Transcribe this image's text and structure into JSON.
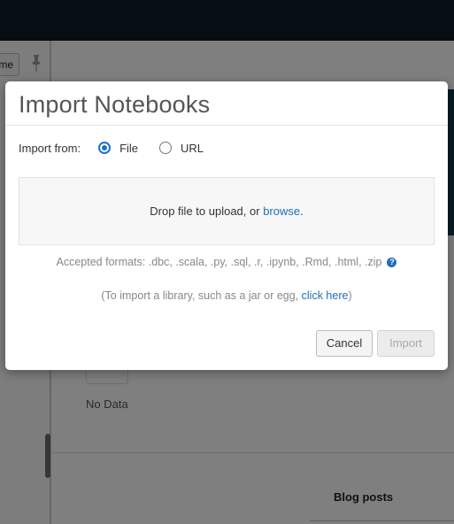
{
  "background": {
    "sidebar_button_label": "me",
    "no_data_text": "No Data",
    "blog_posts_label": "Blog posts"
  },
  "modal": {
    "title": "Import Notebooks",
    "import_from_label": "Import from:",
    "options": [
      {
        "label": "File",
        "selected": true
      },
      {
        "label": "URL",
        "selected": false
      }
    ],
    "dropzone": {
      "text": "Drop file to upload, or ",
      "browse_link": "browse",
      "suffix": "."
    },
    "accepted_formats": "Accepted formats: .dbc, .scala, .py, .sql, .r, .ipynb, .Rmd, .html, .zip",
    "library_prefix": "(To import a library, such as a jar or egg, ",
    "library_link": "click here",
    "library_suffix": ")",
    "buttons": {
      "cancel": "Cancel",
      "import": "Import"
    }
  },
  "colors": {
    "accent": "#1f6fd1",
    "link": "#1e6fb8",
    "topbar": "#0d1b27"
  }
}
